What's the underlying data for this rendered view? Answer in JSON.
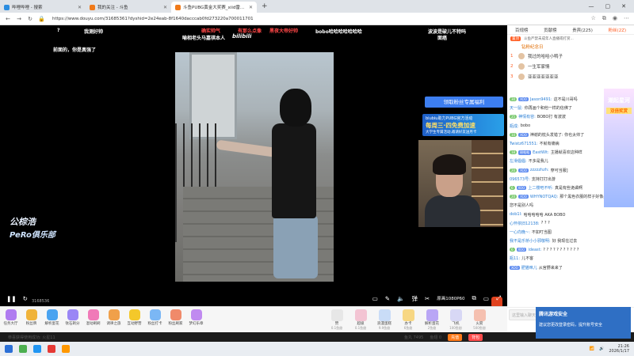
{
  "browser": {
    "tabs": [
      {
        "label": "哔哩哔哩 - 搜索",
        "active": false
      },
      {
        "label": "我的关注 - 斗鱼",
        "active": false
      },
      {
        "label": "斗鱼PUBG黄金大奖赛_xiid雷...",
        "active": true
      }
    ],
    "url": "https://www.douyu.com/31685361?dyshid=2e24eab-8f1640dacccab0fd273220a700011701"
  },
  "video": {
    "danmaku": [
      {
        "text": "?",
        "color": "white"
      },
      {
        "text": "我测好帅",
        "color": "white"
      },
      {
        "text": "喻相老头马嘉祺本人",
        "color": "white"
      },
      {
        "text": "bilibili",
        "color": "white"
      },
      {
        "text": "bobo哈哈哈哈哈哈哈",
        "color": "white"
      },
      {
        "text": "波波是破儿不特吗",
        "color": "white"
      },
      {
        "text": "面癌",
        "color": "white"
      },
      {
        "text": "前面的，你是真强了",
        "color": "white"
      },
      {
        "text": "确实帅气",
        "color": "red"
      },
      {
        "text": "有那么点像",
        "color": "red"
      },
      {
        "text": "黑夜大帝好帅",
        "color": "red"
      }
    ],
    "watermark_line1": "公棕浩",
    "watermark_line2": "PeRo俱乐部",
    "fan_banner": "领取粉丝专属福利",
    "promo_line1": "biubiu助力PUBG官方活动",
    "promo_line2": "每周三·四免费加速",
    "promo_line3": "大学生专属活动,邀请好友送月卡",
    "quality": "原画1080P60",
    "timecode": "3168536"
  },
  "giftbar": {
    "items": [
      "任务大厅",
      "粉丝牌",
      "解析蛋花",
      "钛石剃分",
      "混动刷刷",
      "调律之旅",
      "互动野营",
      "粉丝打卡",
      "粉丝刷家",
      "梦幻乐章"
    ],
    "shop": [
      {
        "name": "赞",
        "sub": "0.1鱼翅"
      },
      {
        "name": "超级",
        "sub": "0.1鱼翅"
      },
      {
        "name": "浪漫蛋糕",
        "sub": "9.9鱼翅"
      },
      {
        "name": "办卡",
        "sub": "6鱼翅"
      },
      {
        "name": "解析蛋花",
        "sub": "2鱼翅"
      },
      {
        "name": "飞机",
        "sub": "100鱼翅"
      },
      {
        "name": "火箭",
        "sub": "500鱼翅"
      }
    ],
    "balance_label": "鱼丸 7495",
    "balance2": "鱼翅 0",
    "recharge": "充值",
    "pay": "背包",
    "marquee": "恭喜获得使用成功: 火星11"
  },
  "sidebar": {
    "tabs": [
      "百规榜",
      "贡献榜",
      "贵宾(225)",
      "粉丝(2Z)"
    ],
    "active_tab": 3,
    "notice_badge": "置顶",
    "notice_text": "斗鱼严禁未成年人直播或打赏...",
    "rank_title": "钻粉纪念日",
    "ranks": [
      {
        "n": "1",
        "name": "我过的哈哈小鸭子"
      },
      {
        "n": "2",
        "name": "一生军家情"
      },
      {
        "n": "3",
        "name": "亚亚亚亚亚亚亚"
      }
    ],
    "side_ad_1": "潮起星河",
    "side_ad_2": "双倍奖赏",
    "chat": [
      {
        "lv": "30",
        "fan": "XOO",
        "user": "Jason9491:",
        "text": "这不是川哥吗"
      },
      {
        "lv": "",
        "fan": "",
        "user": "天一鼠:",
        "text": "你再画个和他一样的信佛了"
      },
      {
        "lv": "25",
        "fan": "",
        "user": "神情有容:",
        "text": "BOBO打 有波波"
      },
      {
        "lv": "",
        "fan": "",
        "user": "瓶成:",
        "text": "bobo"
      },
      {
        "lv": "10",
        "fan": "XOO",
        "user": "",
        "text": "神谢的枕头发错了: 你也太帅了"
      },
      {
        "lv": "",
        "fan": "",
        "user": "Twistz671551:",
        "text": "不就有痛病"
      },
      {
        "lv": "18",
        "fan": "粉蛙蛙",
        "user": "EastWit:",
        "text": "主播就喜欢这种样"
      },
      {
        "lv": "",
        "fan": "",
        "user": "左滑倡倡:",
        "text": "不多是我儿"
      },
      {
        "lv": "20",
        "fan": "XOO",
        "user": "zzzzzhzh:",
        "text": "穿可当服]"
      },
      {
        "lv": "",
        "fan": "",
        "user": "096573号:",
        "text": "支持打打出游"
      },
      {
        "lv": "6",
        "fan": "XOO",
        "user": "上二楼吧不听:",
        "text": "真是有些诡谲啊"
      },
      {
        "lv": "20",
        "fan": "XOO",
        "user": "WHYNOTQAQ:",
        "text": "那个黑色衣服的样子好像是"
      },
      {
        "lv": "",
        "fan": "",
        "user": "",
        "text": "您不是别人吗"
      },
      {
        "lv": "",
        "fan": "",
        "user": "dob1l:",
        "text": "哈哈哈哈哈 AKA BOBO"
      },
      {
        "lv": "",
        "fan": "",
        "user": "心怀依旧12138:",
        "text": "? ? ?"
      },
      {
        "lv": "",
        "fan": "",
        "user": "一心向晚~:",
        "text": "不如叮当图"
      },
      {
        "lv": "",
        "fan": "",
        "user": "我不是乐桥小小邪敬明:",
        "text": "好 我现在过去"
      },
      {
        "lv": "6",
        "fan": "XOO",
        "user": "ideast:",
        "text": "? ? ? ? ? ? ? ? ? ? ?"
      },
      {
        "lv": "",
        "fan": "",
        "user": "瓶11:",
        "text": "儿不客"
      },
      {
        "lv": "",
        "fan": "XOO",
        "user": "肥猫咪儿",
        "text": "从宫野来来了"
      }
    ],
    "input_placeholder": "这里输入聊天内容",
    "send": "发送"
  },
  "toast": {
    "title": "腾讯游戏安全",
    "body": "建议您更改登录密码，提升账号安全"
  },
  "taskbar": {
    "time": "21:26",
    "date": "2026/1/17"
  }
}
